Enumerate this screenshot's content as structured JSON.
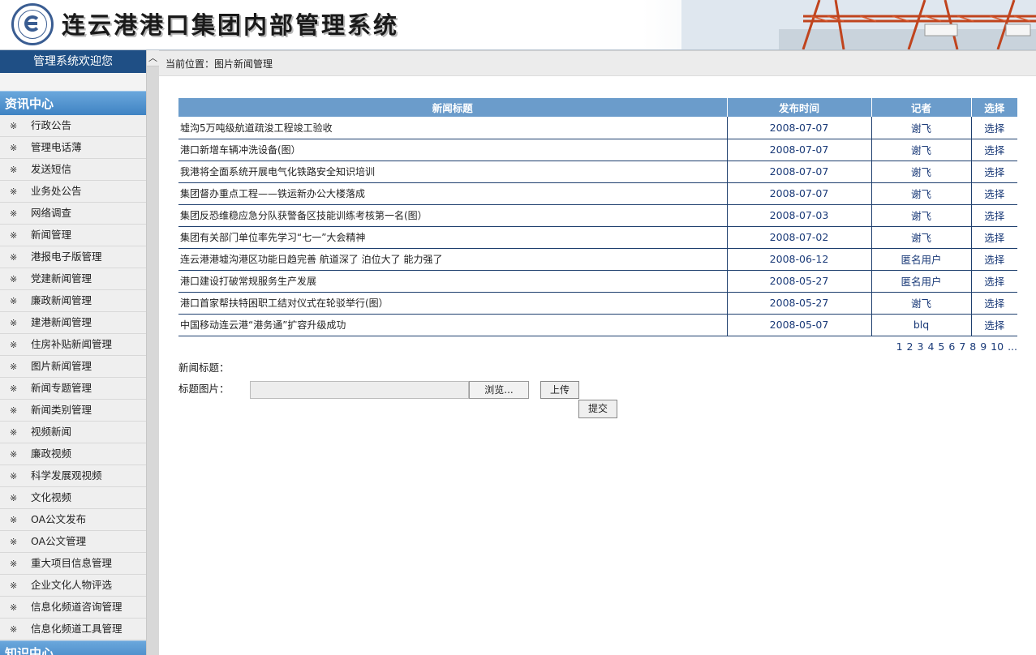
{
  "header": {
    "title": "连云港港口集团内部管理系统",
    "logo_icon": "port-logo-icon"
  },
  "sidebar": {
    "welcome": "管理系统欢迎您",
    "sections": [
      {
        "title": "资讯中心",
        "items": [
          "行政公告",
          "管理电话薄",
          "发送短信",
          "业务处公告",
          "网络调查",
          "新闻管理",
          "港报电子版管理",
          "党建新闻管理",
          "廉政新闻管理",
          "建港新闻管理",
          "住房补贴新闻管理",
          "图片新闻管理",
          "新闻专题管理",
          "新闻类别管理",
          "视频新闻",
          "廉政视频",
          "科学发展观视频",
          "文化视频",
          "OA公文发布",
          "OA公文管理",
          "重大项目信息管理",
          "企业文化人物评选",
          "信息化频道咨询管理",
          "信息化频道工具管理"
        ]
      },
      {
        "title": "知识中心",
        "items": []
      }
    ],
    "item_marker": "※"
  },
  "breadcrumb": "当前位置：图片新闻管理",
  "table": {
    "headers": [
      "新闻标题",
      "发布时间",
      "记者",
      "选择"
    ],
    "rows": [
      [
        "墟沟5万吨级航道疏浚工程竣工验收",
        "2008-07-07",
        "谢飞",
        "选择"
      ],
      [
        "港口新增车辆冲洗设备(图）",
        "2008-07-07",
        "谢飞",
        "选择"
      ],
      [
        "我港将全面系统开展电气化铁路安全知识培训",
        "2008-07-07",
        "谢飞",
        "选择"
      ],
      [
        "集团督办重点工程——铁运新办公大楼落成",
        "2008-07-07",
        "谢飞",
        "选择"
      ],
      [
        "集团反恐维稳应急分队获警备区技能训练考核第一名(图）",
        "2008-07-03",
        "谢飞",
        "选择"
      ],
      [
        "集团有关部门单位率先学习“七一”大会精神",
        "2008-07-02",
        "谢飞",
        "选择"
      ],
      [
        "连云港港墟沟港区功能日趋完善 航道深了 泊位大了 能力强了",
        "2008-06-12",
        "匿名用户",
        "选择"
      ],
      [
        "港口建设打破常规服务生产发展",
        "2008-05-27",
        "匿名用户",
        "选择"
      ],
      [
        "港口首家帮扶特困职工结对仪式在轮驳举行(图）",
        "2008-05-27",
        "谢飞",
        "选择"
      ],
      [
        "中国移动连云港“港务通”扩容升级成功",
        "2008-05-07",
        "blq",
        "选择"
      ]
    ]
  },
  "pager": [
    "1",
    "2",
    "3",
    "4",
    "5",
    "6",
    "7",
    "8",
    "9",
    "10",
    "..."
  ],
  "form": {
    "title_label": "新闻标题：",
    "image_label": "标题图片：",
    "browse_label": "浏览...",
    "upload_label": "上传",
    "submit_label": "提交"
  }
}
